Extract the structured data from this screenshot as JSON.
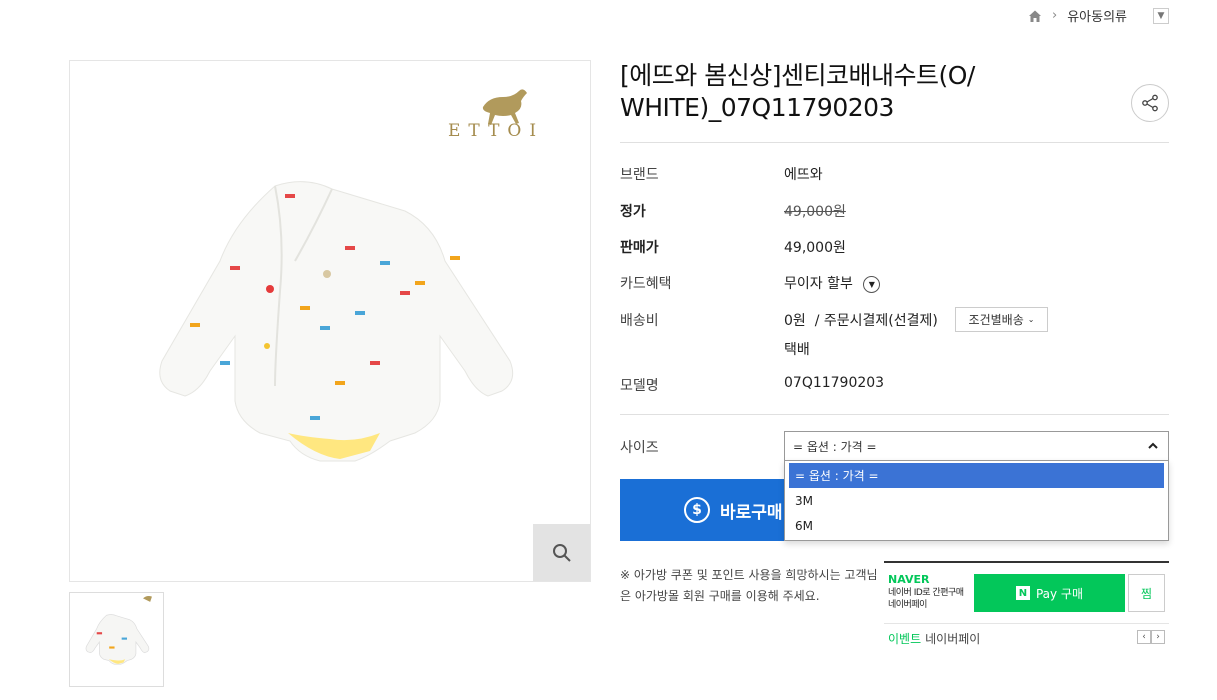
{
  "breadcrumb": {
    "category": "유아동의류"
  },
  "product": {
    "title": "[에뜨와 봄신상]센티코배내수트(O/ WHITE)_07Q11790203",
    "logo_text": "ETTOI"
  },
  "info": {
    "brand_label": "브랜드",
    "brand_value": "에뜨와",
    "price_label": "정가",
    "price_value": "49,000원",
    "sale_label": "판매가",
    "sale_value": "49,000원",
    "card_label": "카드혜택",
    "card_value": "무이자 할부",
    "ship_label": "배송비",
    "ship_value": "0원  / 주문시결제(선결제)",
    "ship_button": "조건별배송",
    "ship_method": "택배",
    "model_label": "모델명",
    "model_value": "07Q11790203"
  },
  "option": {
    "label": "사이즈",
    "selected": "= 옵션 : 가격 =",
    "items": [
      "= 옵션 : 가격 =",
      "3M",
      "6M"
    ]
  },
  "buy_button": "바로구매",
  "notice": "※ 아가방 쿠폰 및 포인트 사용을 희망하시는 고객님은 아가방몰 회원 구매를 이용해 주세요.",
  "npay": {
    "brand": "NAVER",
    "sub_line1": "네이버 ID로 간편구매",
    "sub_line2": "네이버페이",
    "button": "Pay 구매",
    "wish": "찜",
    "event_tag": "이벤트",
    "event_text": "네이버페이"
  },
  "colors": {
    "accent": "#1a6fd6",
    "naver": "#03c75a",
    "selected_option": "#3b73d5"
  }
}
